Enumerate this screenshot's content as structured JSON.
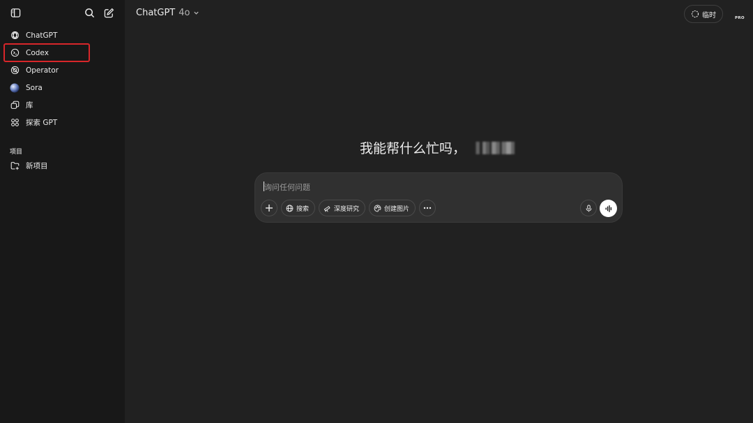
{
  "sidebar": {
    "items": [
      {
        "label": "ChatGPT",
        "icon": "openai-logo-icon"
      },
      {
        "label": "Codex",
        "icon": "codex-icon",
        "highlighted": true
      },
      {
        "label": "Operator",
        "icon": "operator-icon"
      },
      {
        "label": "Sora",
        "icon": "sora-icon"
      },
      {
        "label": "库",
        "icon": "library-icon"
      },
      {
        "label": "探索 GPT",
        "icon": "grid-icon"
      }
    ],
    "projects_label": "项目",
    "new_project_label": "新项目"
  },
  "header": {
    "model_name": "ChatGPT",
    "model_version": "4o",
    "temporary_label": "临时",
    "badge": "PRO"
  },
  "main": {
    "greeting": "我能帮什么忙吗，",
    "composer": {
      "placeholder": "询问任何问题",
      "tools": [
        {
          "label": "搜索",
          "icon": "globe-icon"
        },
        {
          "label": "深度研究",
          "icon": "telescope-icon"
        },
        {
          "label": "创建图片",
          "icon": "palette-icon"
        }
      ]
    }
  },
  "colors": {
    "background": "#212121",
    "sidebar": "#181818",
    "composer": "#303030",
    "highlight_box": "#d8262a"
  }
}
